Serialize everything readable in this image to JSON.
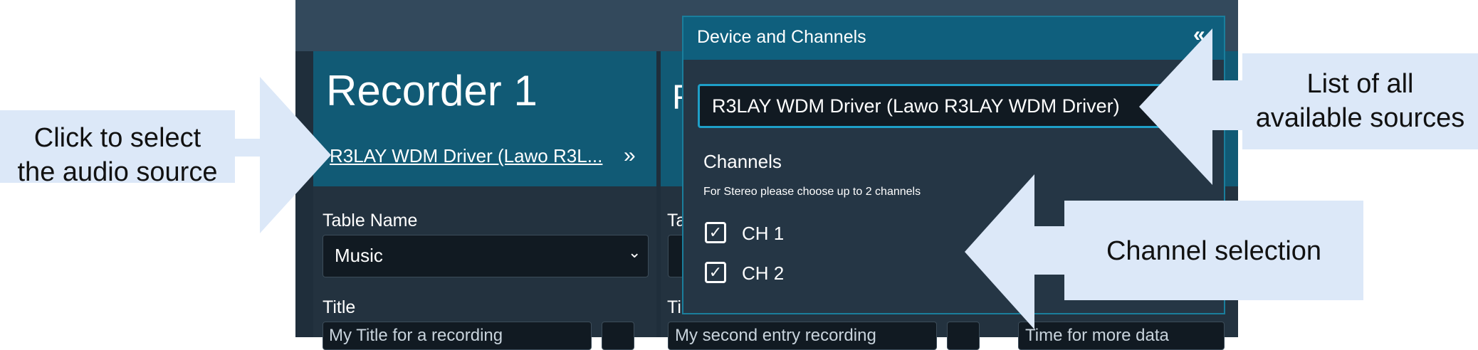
{
  "recorder": {
    "title": "Recorder 1",
    "source_link": "R3LAY WDM Driver (Lawo R3L...",
    "expand_icon": "double-chevron-right-icon",
    "table_name_label": "Table Name",
    "table_name_value": "Music",
    "title_label": "Title",
    "title_value": "My Title for a recording",
    "second_value": "My second entry recording",
    "third_value": "Time for more data"
  },
  "second_recorder": {
    "title_partial": "R",
    "label_partial": "Ta",
    "title_label_partial": "Ti"
  },
  "popup": {
    "title": "Device and Channels",
    "collapse_icon": "double-chevron-left-icon",
    "device_value": "R3LAY WDM Driver (Lawo R3LAY WDM Driver)",
    "channels_title": "Channels",
    "channels_hint": "For Stereo please choose up to 2 channels",
    "channels": [
      {
        "label": "CH 1",
        "checked": true
      },
      {
        "label": "CH 2",
        "checked": true
      }
    ]
  },
  "annotations": {
    "left_line1": "Click to select",
    "left_line2": "the audio source",
    "right_line1": "List of all",
    "right_line2": "available sources",
    "channel": "Channel selection"
  },
  "colors": {
    "header_teal": "#115a75",
    "popup_border": "#1a7e9c",
    "callout_fill": "#dce8f8"
  }
}
